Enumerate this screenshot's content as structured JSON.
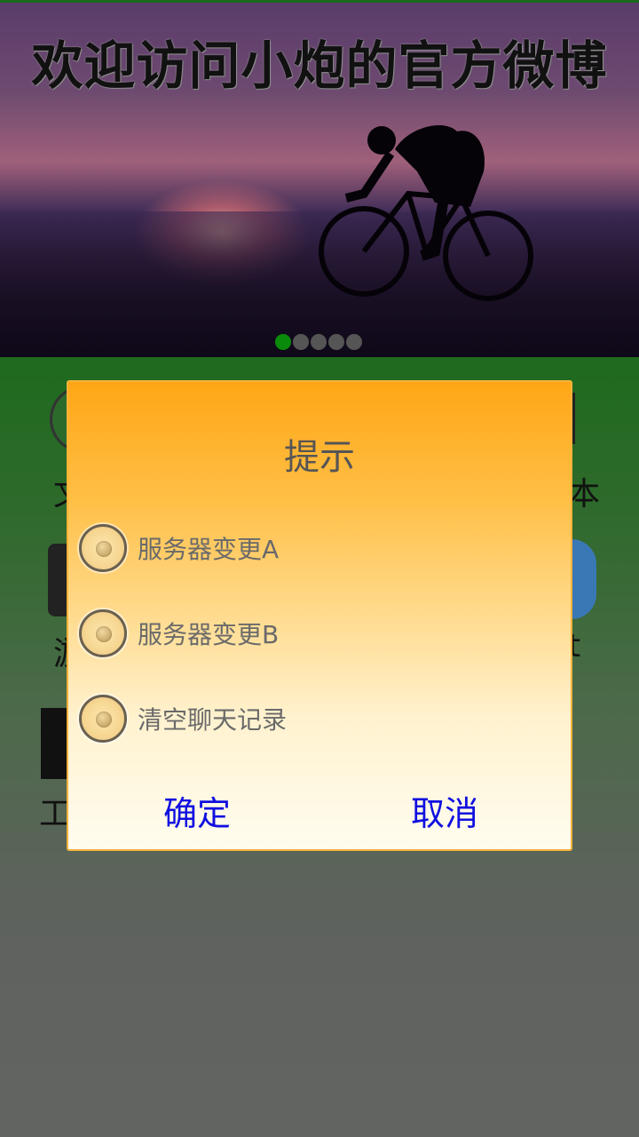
{
  "banner": {
    "title": "欢迎访问小炮的官方微博",
    "dots": [
      true,
      false,
      false,
      false,
      false
    ]
  },
  "background_grid": {
    "peek_labels": [
      "文",
      "本",
      "游",
      "t",
      "工"
    ]
  },
  "dialog": {
    "title": "提示",
    "options": [
      {
        "label": "服务器变更A",
        "selected": false
      },
      {
        "label": "服务器变更B",
        "selected": false
      },
      {
        "label": "清空聊天记录",
        "selected": false
      }
    ],
    "confirm_label": "确定",
    "cancel_label": "取消"
  },
  "colors": {
    "dialog_top": "#ffa616",
    "dialog_bottom": "#fffdf0",
    "button_text": "#1010e0",
    "active_dot": "#0a8a0a"
  }
}
